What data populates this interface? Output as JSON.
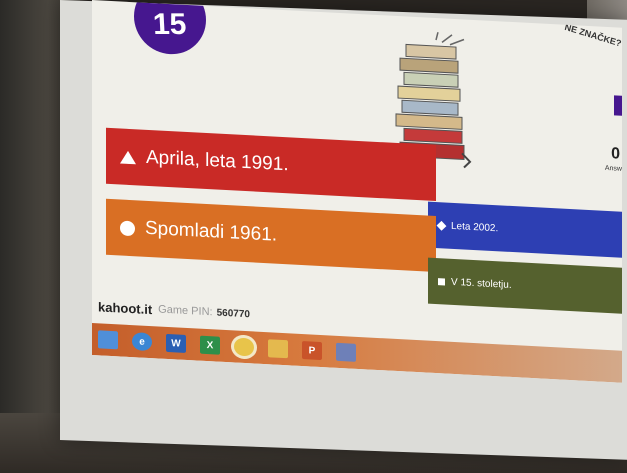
{
  "question": {
    "number": "15"
  },
  "title_fragment": "NE ZNAČKE?",
  "side": {
    "number": "0",
    "sub": "Answ"
  },
  "answers": [
    {
      "shape": "triangle",
      "text": "Aprila, leta 1991.",
      "color": "#c92a26"
    },
    {
      "shape": "diamond",
      "text": "Leta 2002.",
      "color": "#2d3fb3"
    },
    {
      "shape": "circle",
      "text": "Spomladi 1961.",
      "color": "#d96f24"
    },
    {
      "shape": "square",
      "text": "V 15. stoletju.",
      "color": "#55612e"
    }
  ],
  "footer": {
    "brand": "kahoot.it",
    "pin_label": "Game PIN:",
    "pin": "560770"
  },
  "taskbar": {
    "icons": [
      "windows-start-icon",
      "internet-explorer-icon",
      "word-icon",
      "excel-icon",
      "chrome-icon",
      "folder-icon",
      "powerpoint-icon",
      "app-icon"
    ],
    "labels": [
      "",
      "e",
      "W",
      "X",
      "",
      "",
      "P",
      ""
    ]
  },
  "colors": {
    "kahoot_purple": "#46178f"
  }
}
